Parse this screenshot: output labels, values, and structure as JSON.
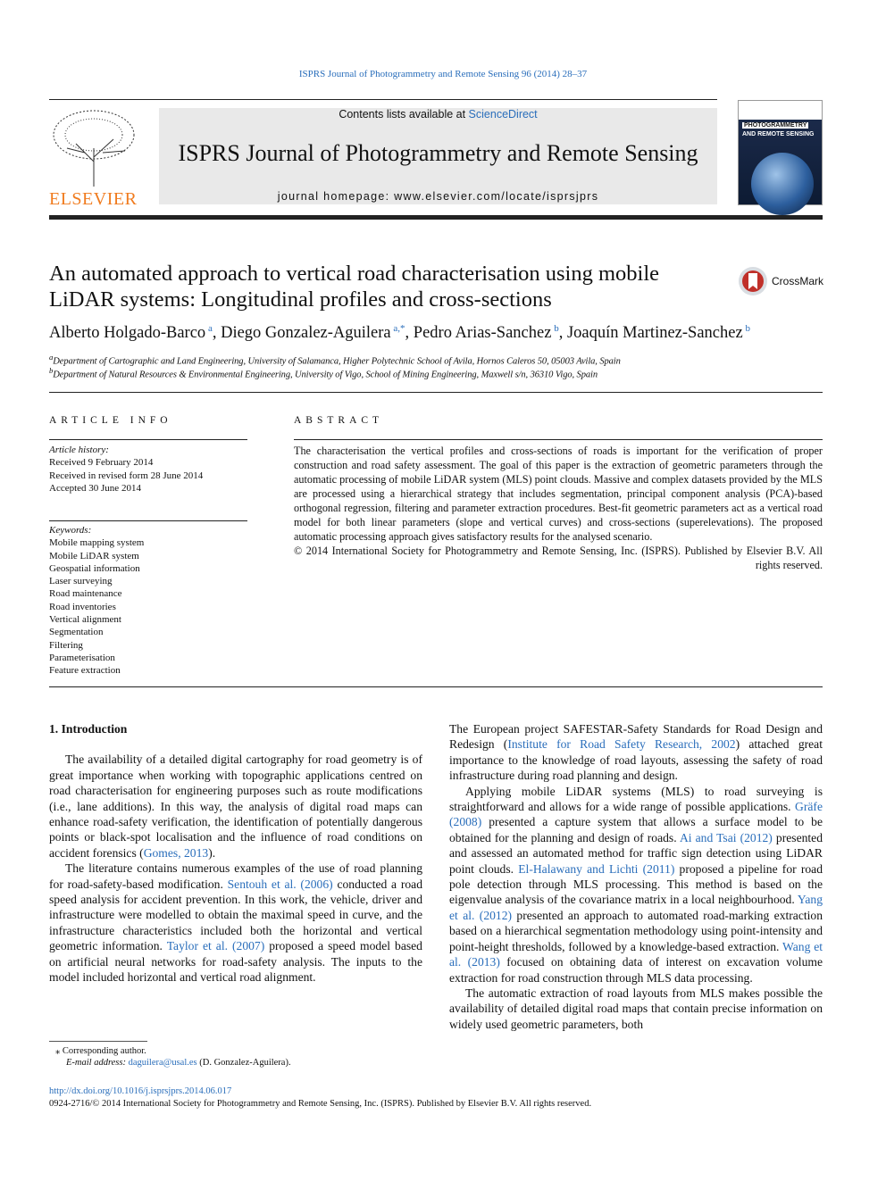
{
  "header": {
    "citation": "ISPRS Journal of Photogrammetry and Remote Sensing 96 (2014) 28–37",
    "contents_prefix": "Contents lists available at ",
    "contents_link": "ScienceDirect",
    "journal_title": "ISPRS Journal of Photogrammetry and Remote Sensing",
    "homepage_prefix": "journal homepage: ",
    "homepage_url": "www.elsevier.com/locate/isprsjprs",
    "publisher_logo": "ELSEVIER",
    "cover_text_1": "PHOTOGRAMMETRY",
    "cover_text_2": "AND REMOTE SENSING",
    "crossmark": "CrossMark"
  },
  "article": {
    "title": "An automated approach to vertical road characterisation using mobile LiDAR systems: Longitudinal profiles and cross-sections",
    "authors": [
      {
        "name": "Alberto Holgado-Barco",
        "sup": "a"
      },
      {
        "name": "Diego Gonzalez-Aguilera",
        "sup": "a,*"
      },
      {
        "name": "Pedro Arias-Sanchez",
        "sup": "b"
      },
      {
        "name": "Joaquín Martinez-Sanchez",
        "sup": "b"
      }
    ],
    "affiliations": [
      {
        "sup": "a",
        "text": "Department of Cartographic and Land Engineering, University of Salamanca, Higher Polytechnic School of Avila, Hornos Caleros 50, 05003 Avila, Spain"
      },
      {
        "sup": "b",
        "text": "Department of Natural Resources & Environmental Engineering, University of Vigo, School of Mining Engineering, Maxwell s/n, 36310 Vigo, Spain"
      }
    ]
  },
  "info": {
    "heading": "ARTICLE INFO",
    "history_label": "Article history:",
    "history": [
      "Received 9 February 2014",
      "Received in revised form 28 June 2014",
      "Accepted 30 June 2014"
    ],
    "keywords_label": "Keywords:",
    "keywords": [
      "Mobile mapping system",
      "Mobile LiDAR system",
      "Geospatial information",
      "Laser surveying",
      "Road maintenance",
      "Road inventories",
      "Vertical alignment",
      "Segmentation",
      "Filtering",
      "Parameterisation",
      "Feature extraction"
    ]
  },
  "abstract": {
    "heading": "ABSTRACT",
    "text": "The characterisation the vertical profiles and cross-sections of roads is important for the verification of proper construction and road safety assessment. The goal of this paper is the extraction of geometric parameters through the automatic processing of mobile LiDAR system (MLS) point clouds. Massive and complex datasets provided by the MLS are processed using a hierarchical strategy that includes segmentation, principal component analysis (PCA)-based orthogonal regression, filtering and parameter extraction procedures. Best-fit geometric parameters act as a vertical road model for both linear parameters (slope and vertical curves) and cross-sections (superelevations). The proposed automatic processing approach gives satisfactory results for the analysed scenario.",
    "copyright": "© 2014 International Society for Photogrammetry and Remote Sensing, Inc. (ISPRS). Published by Elsevier B.V. All rights reserved."
  },
  "body": {
    "section_title": "1. Introduction",
    "left": [
      [
        {
          "t": "The availability of a detailed digital cartography for road geometry is of great importance when working with topographic applications centred on road characterisation for engineering purposes such as route modifications (i.e., lane additions). In this way, the analysis of digital road maps can enhance road-safety verification, the identification of potentially dangerous points or black-spot localisation and the influence of road conditions on accident forensics ("
        },
        {
          "t": "Gomes, 2013",
          "l": 1
        },
        {
          "t": ")."
        }
      ],
      [
        {
          "t": "The literature contains numerous examples of the use of road planning for road-safety-based modification. "
        },
        {
          "t": "Sentouh et al. (2006)",
          "l": 1
        },
        {
          "t": " conducted a road speed analysis for accident prevention. In this work, the vehicle, driver and infrastructure were modelled to obtain the maximal speed in curve, and the infrastructure characteristics included both the horizontal and vertical geometric information. "
        },
        {
          "t": "Taylor et al. (2007)",
          "l": 1
        },
        {
          "t": " proposed a speed model based on artificial neural networks for road-safety analysis. The inputs to the model included horizontal and vertical road alignment."
        }
      ]
    ],
    "right": [
      [
        {
          "t": "The European project SAFESTAR-Safety Standards for Road Design and Redesign ("
        },
        {
          "t": "Institute for Road Safety Research, 2002",
          "l": 1
        },
        {
          "t": ") attached great importance to the knowledge of road layouts, assessing the safety of road infrastructure during road planning and design."
        }
      ],
      [
        {
          "t": "Applying mobile LiDAR systems (MLS) to road surveying is straightforward and allows for a wide range of possible applications. "
        },
        {
          "t": "Gräfe (2008)",
          "l": 1
        },
        {
          "t": " presented a capture system that allows a surface model to be obtained for the planning and design of roads. "
        },
        {
          "t": "Ai and Tsai (2012)",
          "l": 1
        },
        {
          "t": " presented and assessed an automated method for traffic sign detection using LiDAR point clouds. "
        },
        {
          "t": "El-Halawany and Lichti (2011)",
          "l": 1
        },
        {
          "t": " proposed a pipeline for road pole detection through MLS processing. This method is based on the eigenvalue analysis of the covariance matrix in a local neighbourhood. "
        },
        {
          "t": "Yang et al. (2012)",
          "l": 1
        },
        {
          "t": " presented an approach to automated road-marking extraction based on a hierarchical segmentation methodology using point-intensity and point-height thresholds, followed by a knowledge-based extraction. "
        },
        {
          "t": "Wang et al. (2013)",
          "l": 1
        },
        {
          "t": " focused on obtaining data of interest on excavation volume extraction for road construction through MLS data processing."
        }
      ],
      [
        {
          "t": "The automatic extraction of road layouts from MLS makes possible the availability of detailed digital road maps that contain precise information on widely used geometric parameters, both"
        }
      ]
    ]
  },
  "footnote": {
    "corresponding": "Corresponding author.",
    "email_label": "E-mail address: ",
    "email": "daguilera@usal.es",
    "email_suffix": " (D. Gonzalez-Aguilera)."
  },
  "footer": {
    "doi": "http://dx.doi.org/10.1016/j.isprsjprs.2014.06.017",
    "issn": "0924-2716/© 2014 International Society for Photogrammetry and Remote Sensing, Inc. (ISPRS). Published by Elsevier B.V. All rights reserved."
  }
}
